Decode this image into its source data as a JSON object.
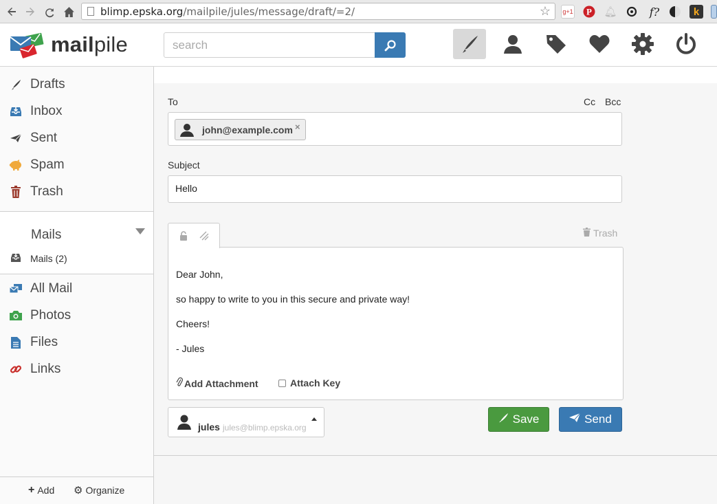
{
  "browser": {
    "url_host": "blimp.epska.org",
    "url_path": "/mailpile/jules/message/draft/=2/",
    "icons": [
      "back-icon",
      "forward-icon",
      "reload-icon",
      "home-icon",
      "star-icon"
    ],
    "extensions": [
      "google-plus-extension",
      "pinterest-extension",
      "notification-extension",
      "sync-extension",
      "font-extension",
      "contrast-extension",
      "k-extension"
    ],
    "ext_gplus": "g+1",
    "ext_font": "f?",
    "ext_k": "k"
  },
  "app": {
    "logo_text_bold": "mail",
    "logo_text_rest": "pile",
    "search_placeholder": "search",
    "top_icons": [
      "compose-icon",
      "contacts-icon",
      "tags-icon",
      "favorites-icon",
      "settings-icon",
      "logout-icon"
    ]
  },
  "sidebar": {
    "items": [
      {
        "label": "Drafts",
        "icon": "pencil-icon"
      },
      {
        "label": "Inbox",
        "icon": "inbox-icon"
      },
      {
        "label": "Sent",
        "icon": "paper-plane-icon"
      },
      {
        "label": "Spam",
        "icon": "pig-icon"
      },
      {
        "label": "Trash",
        "icon": "trash-icon"
      }
    ],
    "tags_heading": "Mails",
    "tag_sub": "Mails (2)",
    "more_items": [
      {
        "label": "All Mail",
        "icon": "mails-icon"
      },
      {
        "label": "Photos",
        "icon": "camera-icon"
      },
      {
        "label": "Files",
        "icon": "file-icon"
      },
      {
        "label": "Links",
        "icon": "link-icon"
      }
    ],
    "footer_add": "Add",
    "footer_organize": "Organize"
  },
  "compose": {
    "to_label": "To",
    "cc_label": "Cc",
    "bcc_label": "Bcc",
    "recipient": "john@example.com",
    "remove_mark": "×",
    "subject_label": "Subject",
    "subject_value": "Hello",
    "trash_label": "Trash",
    "body": [
      "Dear John,",
      "so happy to write to you in this secure and private way!",
      "Cheers!",
      "- Jules"
    ],
    "add_attachment": "Add Attachment",
    "attach_key": "Attach Key",
    "from_name": "jules",
    "from_address": "jules@blimp.epska.org",
    "save_label": "Save",
    "send_label": "Send",
    "colors": {
      "save": "#4a9a3f",
      "send": "#3a7ab3",
      "search_button": "#3a7ab3"
    }
  }
}
